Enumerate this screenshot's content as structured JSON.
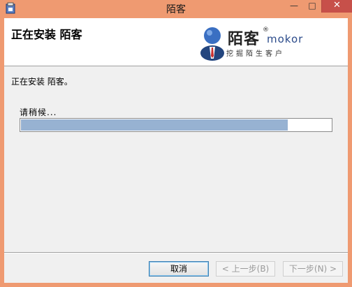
{
  "window": {
    "title": "陌客",
    "controls": {
      "minimize": "—",
      "maximize": "□",
      "close": "✕"
    }
  },
  "header": {
    "title": "正在安装 陌客",
    "logo": {
      "name": "陌客",
      "registered": "®",
      "latin": "mokor",
      "slogan": "挖掘陌生客户"
    }
  },
  "body": {
    "status": "正在安装 陌客。",
    "wait": "请稍候...",
    "progress": 0.86
  },
  "buttons": {
    "cancel": "取消",
    "back": "< 上一步(B)",
    "next": "下一步(N) >"
  },
  "colors": {
    "titlebar": "#ef9a71",
    "progress_fill": "#97b2d2",
    "close": "#c7504a"
  }
}
